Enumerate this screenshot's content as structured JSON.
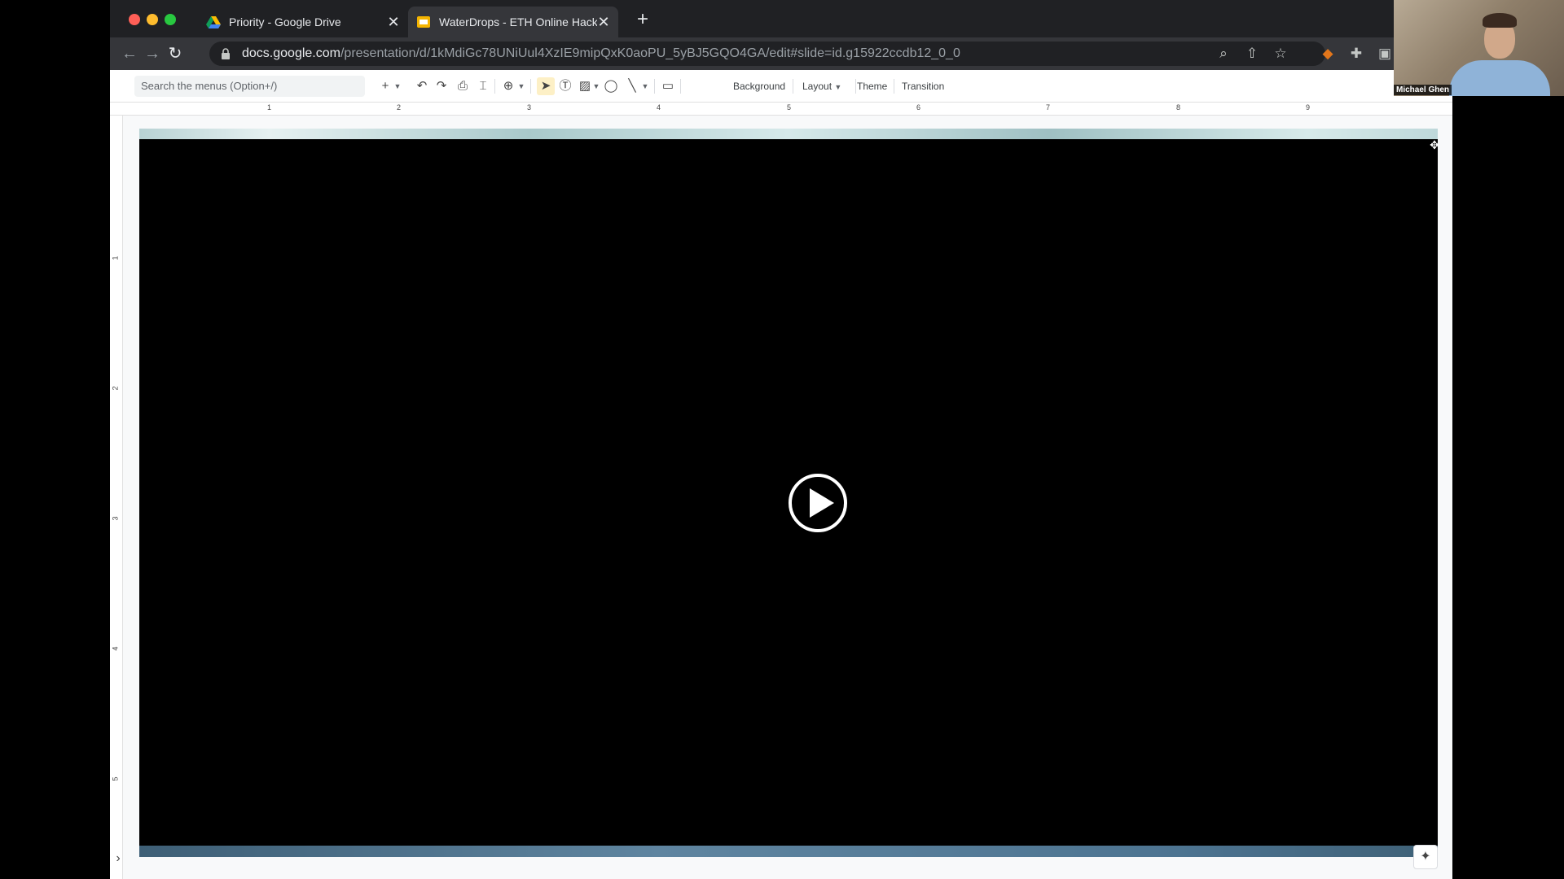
{
  "browser": {
    "tabs": [
      {
        "title": "Priority - Google Drive",
        "favicon": "google-drive-icon",
        "active": false
      },
      {
        "title": "WaterDrops - ETH Online Hack",
        "favicon": "google-slides-icon",
        "active": true
      }
    ],
    "tab_close_glyph": "✕",
    "new_tab_glyph": "+",
    "url_host": "docs.google.com",
    "url_path": "/presentation/d/1kMdiGc78UNiUul4XzIE9mipQxK0aoPU_5yBJ5GQO4GA/edit#slide=id.g15922ccdb12_0_0"
  },
  "toolbar": {
    "search_placeholder": "Search the menus (Option+/)",
    "background_label": "Background",
    "layout_label": "Layout",
    "theme_label": "Theme",
    "transition_label": "Transition"
  },
  "ruler": {
    "horizontal": [
      "1",
      "2",
      "3",
      "4",
      "5",
      "6",
      "7",
      "8",
      "9"
    ],
    "vertical": [
      "1",
      "2",
      "3",
      "4",
      "5"
    ]
  },
  "webcam": {
    "name": "Michael Ghen"
  },
  "colors": {
    "chrome_dark": "#202124",
    "chrome_toolbar": "#35363a",
    "slide_background": "#000000",
    "slide_top_band": "#b8d2d4",
    "slide_bottom_band": "#4d7491",
    "select_tool_highlight": "#fdf0c6"
  }
}
